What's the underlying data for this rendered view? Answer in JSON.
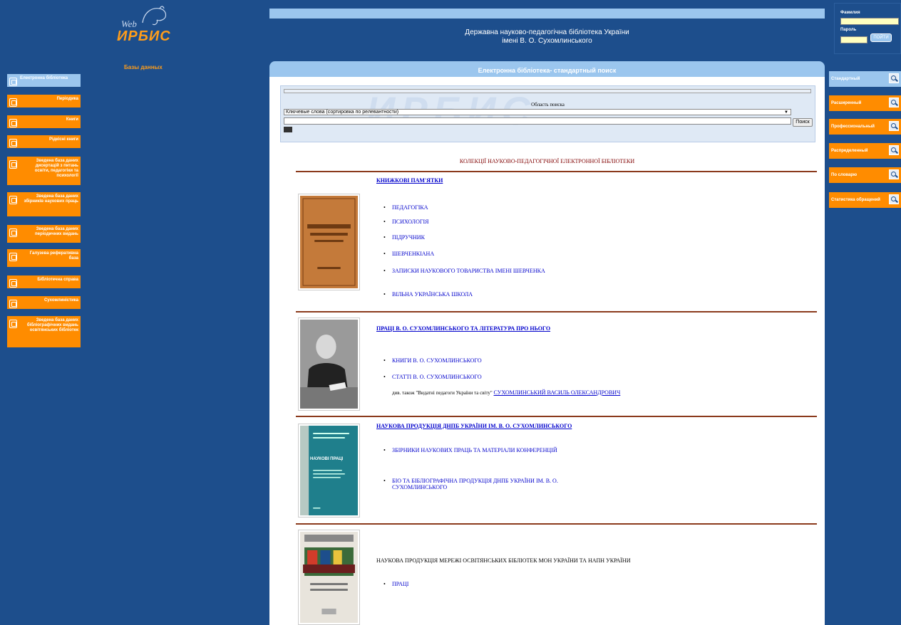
{
  "logo": {
    "web": "Web",
    "irbis": "ИРБИС"
  },
  "left": {
    "header": "Базы данных",
    "items": [
      {
        "label": "Електронна бібліотека"
      },
      {
        "label": "Періодика"
      },
      {
        "label": "Книги"
      },
      {
        "label": "Рідкісні книги"
      },
      {
        "label": "Зведена база даних дисертацій з питань освіти, педагогіки та психології"
      },
      {
        "label": "Зведена база даних збірників наукових праць"
      },
      {
        "label": "Зведена база даних періодичних видань"
      },
      {
        "label": "Галузева реферативна база"
      },
      {
        "label": "Бібліотечна справа"
      },
      {
        "label": "Сухомлиністика"
      },
      {
        "label": "Зведена база даних бібліографічних видань освітянських бібліотек"
      }
    ]
  },
  "header": {
    "title_line1": "Державна науково-педагогічна бібліотека України",
    "title_line2": "імені В. О. Сухомлинського"
  },
  "search": {
    "bar_title": "Електронна бібліотека- стандартный поиск",
    "area_label": "Область поиска",
    "selected": "Ключевые слова (сортировка по релевантности)",
    "button": "Поиск",
    "watermark": "ИРБИС"
  },
  "collections_title": "КОЛЕКЦІЇ НАУКОВО-ПЕДАГОГІЧНОЇ ЕЛЕКТРОННОЇ БІБЛІОТЕКИ",
  "sections": [
    {
      "title": "КНИЖКОВІ ПАМ'ЯТКИ",
      "items": [
        "ПЕДАГОГІКА",
        "ПСИХОЛОГІЯ",
        "ПІДРУЧНИК",
        "ШЕВЧЕНКІАНА",
        "ЗАПИСКИ НАУКОВОГО ТОВАРИСТВА ІМЕНІ ШЕВЧЕНКА",
        "ВІЛЬНА УКРАЇНСЬКА ШКОЛА"
      ]
    },
    {
      "title": "ПРАЦІ В. О. СУХОМЛИНСЬКОГО ТА ЛІТЕРАТУРА ПРО НЬОГО",
      "items": [
        "КНИГИ В. О. СУХОМЛИНСЬКОГО",
        "СТАТТІ В. О. СУХОМЛИНСЬКОГО"
      ],
      "note_prefix": "див. також \"Видатні педагоги України та світу\"",
      "note_link": "СУХОМЛИНСЬКИЙ ВАСИЛЬ ОЛЕКСАНДРОВИЧ"
    },
    {
      "title": "НАУКОВА ПРОДУКЦІЯ ДНПБ УКРАЇНИ ІМ. В. О. СУХОМЛИНСЬКОГО",
      "items": [
        "ЗБІРНИКИ НАУКОВИХ ПРАЦЬ ТА МАТЕРІАЛИ КОНФЕРЕНЦІЙ",
        "БІО ТА БІБЛІОГРАФІЧНА ПРОДУКЦІЯ ДНПБ УКРАЇНИ ІМ. В. О. СУХОМЛИНСЬКОГО"
      ],
      "thumb_title": "НАУКОВІ ПРАЦІ"
    },
    {
      "title": "НАУКОВА ПРОДУКЦІЯ МЕРЕЖІ ОСВІТЯНСЬКИХ БІБЛІОТЕК МОН УКРАЇНИ ТА НАПН УКРАЇНИ",
      "items": [
        "ПРАЦІ"
      ]
    }
  ],
  "login": {
    "surname_label": "Фамилия",
    "password_label": "Пароль",
    "button": "ПОЙТИ"
  },
  "right": {
    "items": [
      {
        "label": "Стандартный"
      },
      {
        "label": "Расширенный"
      },
      {
        "label": "Профессиональный"
      },
      {
        "label": "Распределенный"
      },
      {
        "label": "По словарю"
      },
      {
        "label": "Статистика обращений"
      }
    ]
  },
  "colors": {
    "background": "#1d4e8c",
    "accent": "#ff8c00",
    "active": "#9bc6ee",
    "rule": "#8b3a1c"
  }
}
